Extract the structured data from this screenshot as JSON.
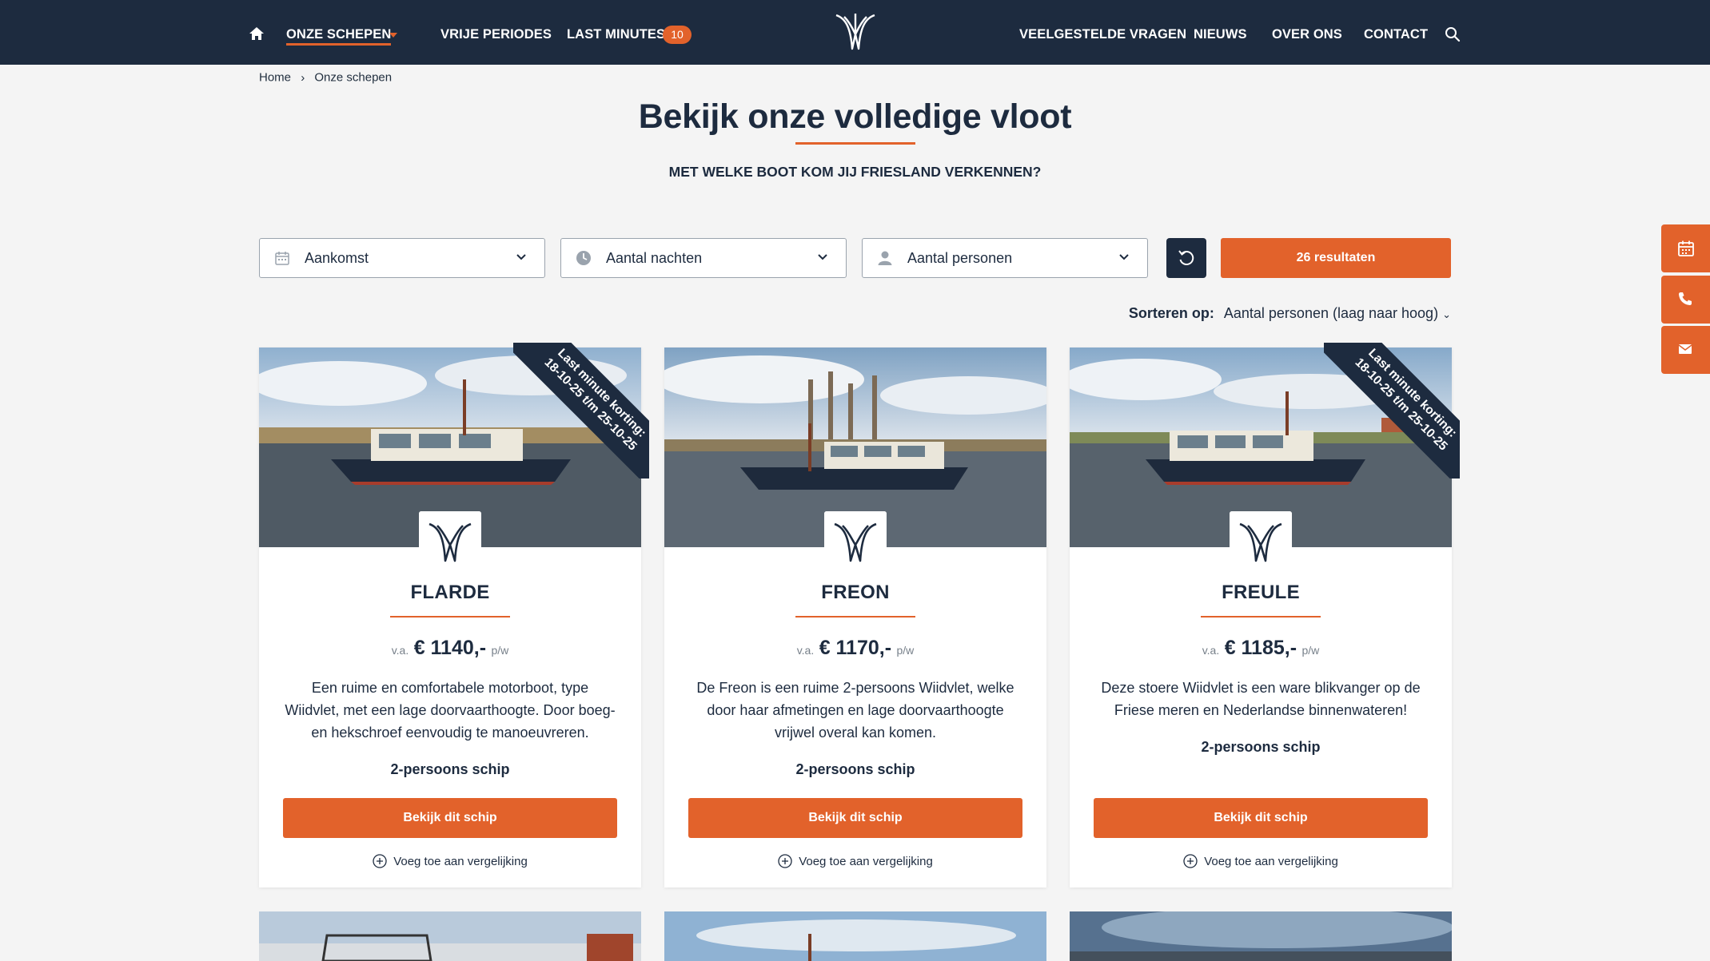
{
  "nav": {
    "left": [
      {
        "label": "ONZE SCHEPEN",
        "active": true
      },
      {
        "label": "VRIJE PERIODES"
      },
      {
        "label": "LAST MINUTES",
        "badge": "10"
      }
    ],
    "right": [
      {
        "label": "VEELGESTELDE VRAGEN"
      },
      {
        "label": "NIEUWS"
      },
      {
        "label": "OVER ONS"
      },
      {
        "label": "CONTACT"
      }
    ],
    "icons": [
      "home-icon",
      "logo-icon",
      "search-icon"
    ]
  },
  "breadcrumb": [
    "Home",
    "Onze schepen"
  ],
  "page": {
    "title": "Bekijk onze volledige vloot",
    "subtitle": "MET WELKE BOOT KOM JIJ FRIESLAND VERKENNEN?"
  },
  "filters": {
    "arrival": "Aankomst",
    "nights": "Aantal nachten",
    "persons": "Aantal personen",
    "results": "26 resultaten"
  },
  "sort": {
    "label": "Sorteren op:",
    "value": "Aantal personen (laag naar hoog)"
  },
  "cards": [
    {
      "name": "FLARDE",
      "price_prefix": "v.a.",
      "price": "€ 1140,-",
      "price_suffix": "p/w",
      "description": "Een ruime en comfortabele motorboot, type Wiidvlet, met een lage doorvaarthoogte. Door boeg- en hekschroef eenvoudig te manoeuvreren.",
      "capacity": "2-persoons schip",
      "button": "Bekijk dit schip",
      "compare": "Voeg toe aan vergelijking",
      "ribbon_line1": "Last minute korting:",
      "ribbon_line2": "18-10-25 t/m 25-10-25"
    },
    {
      "name": "FREON",
      "price_prefix": "v.a.",
      "price": "€ 1170,-",
      "price_suffix": "p/w",
      "description": "De Freon is een ruime 2-persoons Wiidvlet, welke door haar afmetingen en lage doorvaarthoogte vrijwel overal kan komen.",
      "capacity": "2-persoons schip",
      "button": "Bekijk dit schip",
      "compare": "Voeg toe aan vergelijking"
    },
    {
      "name": "FREULE",
      "price_prefix": "v.a.",
      "price": "€ 1185,-",
      "price_suffix": "p/w",
      "description": "Deze stoere Wiidvlet is een ware blikvanger op de Friese meren en Nederlandse binnenwateren!",
      "capacity": "2-persoons schip",
      "button": "Bekijk dit schip",
      "compare": "Voeg toe aan vergelijking",
      "ribbon_line1": "Last minute korting:",
      "ribbon_line2": "18-10-25 t/m 25-10-25"
    }
  ],
  "side_tabs": [
    "calendar-icon",
    "phone-icon",
    "mail-icon"
  ],
  "colors": {
    "navy": "#1d2b3f",
    "orange": "#e2622b",
    "background": "#f4f4f4"
  }
}
